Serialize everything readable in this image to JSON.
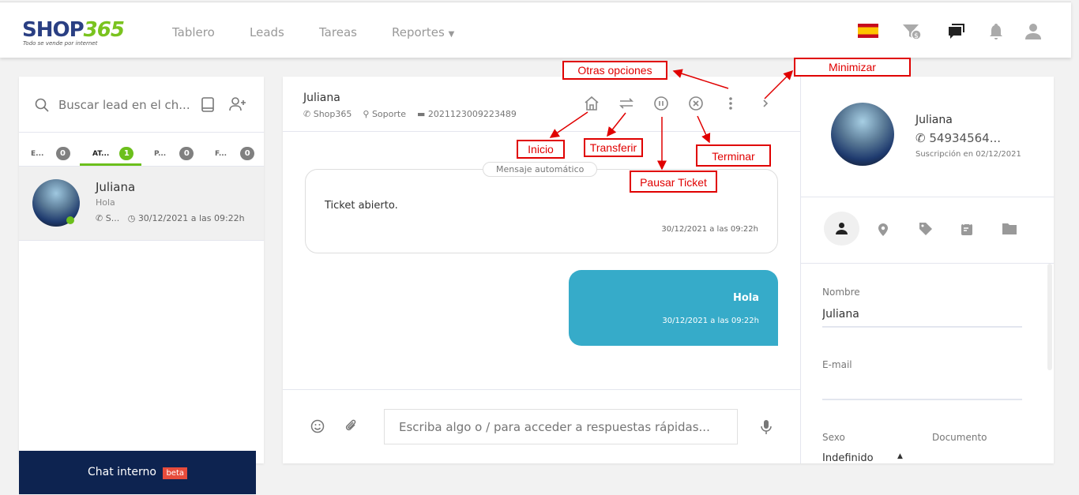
{
  "nav": {
    "logo_text": "SHOP365",
    "logo_tagline": "Todo se vende por internet",
    "items": [
      "Tablero",
      "Leads",
      "Tareas",
      "Reportes"
    ],
    "icons": [
      "spain-flag-icon",
      "funnel-dollar-icon",
      "chat-icon",
      "bell-icon",
      "user-icon"
    ]
  },
  "sidebar": {
    "search_placeholder": "Buscar lead en el ch...",
    "tabs": [
      {
        "label": "E...",
        "count": "0"
      },
      {
        "label": "AT...",
        "count": "1",
        "active": true
      },
      {
        "label": "P...",
        "count": "0"
      },
      {
        "label": "F...",
        "count": "0"
      }
    ],
    "leads": [
      {
        "name": "Juliana",
        "last_message": "Hola",
        "channel": "S...",
        "time": "30/12/2021 a las 09:22h",
        "online": true
      }
    ],
    "internal_chat": {
      "label": "Chat interno",
      "badge": "beta"
    }
  },
  "chat": {
    "contact_name": "Juliana",
    "channel": "Shop365",
    "department": "Soporte",
    "ticket": "2021123009223489",
    "auto_label": "Mensaje automático",
    "messages": [
      {
        "text": "Ticket abierto.",
        "time": "30/12/2021 a las 09:22h",
        "type": "system"
      },
      {
        "text": "Hola",
        "time": "30/12/2021 a las 09:22h",
        "type": "outgoing"
      }
    ],
    "input_placeholder": "Escriba algo o / para acceder a respuestas rápidas..."
  },
  "profile": {
    "name": "Juliana",
    "phone": "54934564...",
    "subscription": "Suscripción en 02/12/2021",
    "fields": {
      "name_label": "Nombre",
      "name_value": "Juliana",
      "email_label": "E-mail",
      "email_value": "",
      "sex_label": "Sexo",
      "sex_value": "Indefinido",
      "doc_label": "Documento"
    }
  },
  "annotations": {
    "otras": "Otras opciones",
    "minimizar": "Minimizar",
    "inicio": "Inicio",
    "transferir": "Transferir",
    "terminar": "Terminar",
    "pausar": "Pausar Ticket"
  },
  "colors": {
    "accent": "#7ac31f",
    "bubble": "#36abc9",
    "navy": "#0d2350",
    "annotation": "#e00000"
  }
}
